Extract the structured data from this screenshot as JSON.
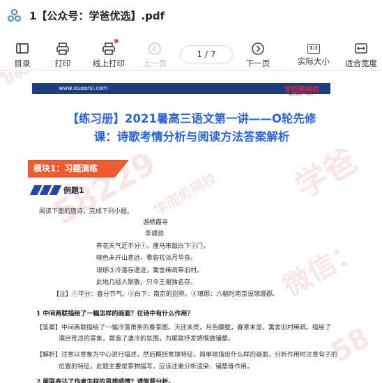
{
  "window": {
    "title": "1【公众号：学爸优选】.pdf"
  },
  "toolbar": {
    "outline": "目录",
    "print": "打印",
    "online_print": "线上打印",
    "prev_page": "上一页",
    "page_indicator": "1  / 7",
    "next_page": "下一页",
    "actual_size": "实际大小",
    "fit_width": "适合宽度",
    "actual_size_glyph": "1:1"
  },
  "document": {
    "banner_url": "www.xueersi.com",
    "brand": "学而思网校",
    "brand_tagline": "每天进步一点点",
    "heading_line1": "【练习册】2021暑高三语文第一讲——O轮先修",
    "heading_line2": "课：诗歌考情分析与阅读方法答案解析",
    "module": "模块1：习题演练",
    "example": "例题1",
    "intro": "阅读下面的唐诗，完成下列小题。",
    "poem_title": "游栖霞寺",
    "poem_author": "李建勋",
    "poem_lines": [
      "养花天气近平分①，瘦马来敲白下②门，",
      "晓色未开山意远，春容犹淡月华昏。",
      "琅琊③冷落存遗迹，篱舍稀疏带旧村。",
      "此地几经人聚散，只今王谢独名存。"
    ],
    "note": "【注】①平分：春分节气。②白下：南京的别称。③琅琊：六朝时南京设琅琊郡。",
    "question1": "1  中间两联描绘了一幅怎样的画面？在诗中有什么作用？",
    "answer_line1": "【答案】中间两联描绘了一幅冷落萧条的春景图。天还未亮，月色朦胧，春意未显，篱舍旧村稀疏。描绘了",
    "answer_line2": "满目荒凉的景象，营造了凄冷的氛围，为尾联抒发感慨做铺垫。",
    "analysis_line1": "【解析】注意以意象为中心进行描述，然后概括意境特征，简单地指出什么样的画面，分析作用时注意句子的",
    "analysis_line2": "位置的特征，此题主要是景物描写，应该注重分析渲染、铺垫等作用。",
    "question2": "2  尾联表达了作者怎样的思想感情？请简要分析。"
  },
  "watermarks": [
    "学爸",
    "微信：",
    "58229",
    "学而思网校",
    "学爸",
    "微信：",
    "58"
  ]
}
